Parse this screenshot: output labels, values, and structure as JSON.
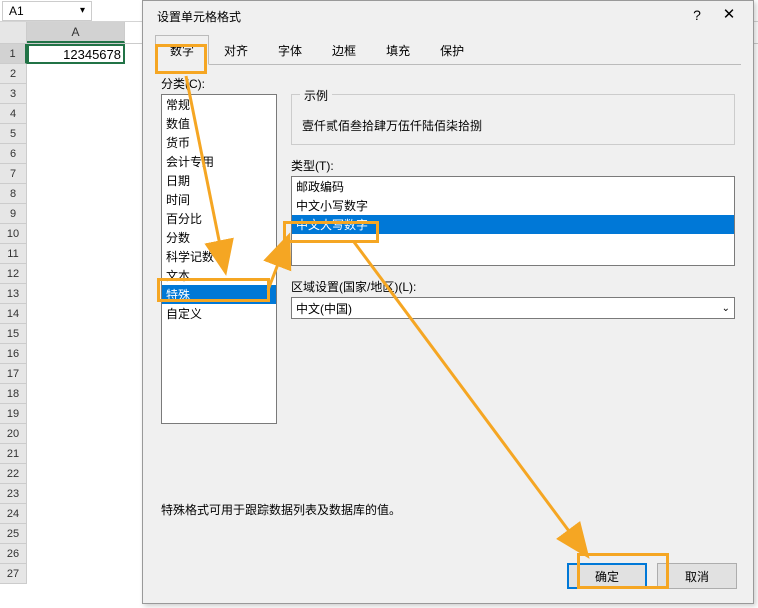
{
  "spreadsheet": {
    "namebox": "A1",
    "col_a": "A",
    "cell_a1": "12345678",
    "row_count": 27
  },
  "dialog": {
    "title": "设置单元格格式",
    "tabs": [
      "数字",
      "对齐",
      "字体",
      "边框",
      "填充",
      "保护"
    ],
    "category_label": "分类(C):",
    "categories": [
      "常规",
      "数值",
      "货币",
      "会计专用",
      "日期",
      "时间",
      "百分比",
      "分数",
      "科学记数",
      "文本",
      "特殊",
      "自定义"
    ],
    "category_selected_index": 10,
    "sample_label": "示例",
    "sample_value": "壹仟贰佰叁拾肆万伍仟陆佰柒拾捌",
    "type_label": "类型(T):",
    "types": [
      "邮政编码",
      "中文小写数字",
      "中文大写数字"
    ],
    "type_selected_index": 2,
    "locale_label": "区域设置(国家/地区)(L):",
    "locale_value": "中文(中国)",
    "hint": "特殊格式可用于跟踪数据列表及数据库的值。",
    "ok": "确定",
    "cancel": "取消"
  }
}
